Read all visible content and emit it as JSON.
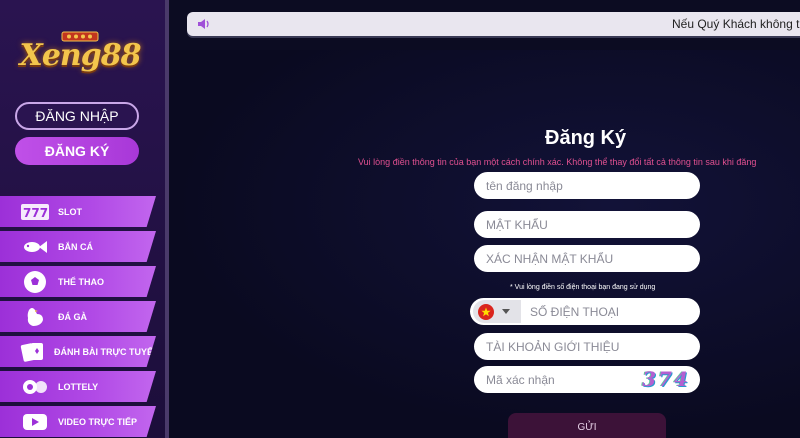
{
  "sidebar": {
    "logo_text": "Xeng88",
    "login_label": "ĐĂNG NHẬP",
    "register_label": "ĐĂNG KÝ",
    "menu": [
      {
        "label": "SLOT",
        "icon": "slot-777-icon"
      },
      {
        "label": "BẮN CÁ",
        "icon": "fish-icon"
      },
      {
        "label": "THỂ THAO",
        "icon": "soccer-ball-icon"
      },
      {
        "label": "ĐÁ GÀ",
        "icon": "rooster-icon"
      },
      {
        "label": "ĐÁNH BÀI TRỰC TUYẾN",
        "icon": "playing-cards-icon"
      },
      {
        "label": "LOTTELY",
        "icon": "lottery-balls-icon"
      },
      {
        "label": "VIDEO TRỰC TIẾP",
        "icon": "youtube-play-icon"
      }
    ]
  },
  "notice": {
    "text": "Nếu Quý Khách không th",
    "icon": "speaker-icon"
  },
  "form": {
    "title": "Đăng Ký",
    "subtitle": "Vui lòng điền thông tin của bạn một cách chính xác. Không thể thay đổi tất cả thông tin sau khi đăng",
    "username_placeholder": "tên đăng nhập",
    "password_placeholder": "MẬT KHẨU",
    "confirm_placeholder": "XÁC NHẬN MẬT KHẨU",
    "phone_note": "* Vui lòng điền số điện thoại bạn đang sử dụng",
    "phone_placeholder": "SỐ ĐIỆN THOẠI",
    "referral_placeholder": "TÀI KHOẢN GIỚI THIỆU",
    "captcha_placeholder": "Mã xác nhận",
    "captcha_code": "374",
    "submit_label": "GỬI"
  },
  "colors": {
    "accent": "#b14ae6",
    "subtitle": "#e05090",
    "background": "#0c0c22"
  }
}
